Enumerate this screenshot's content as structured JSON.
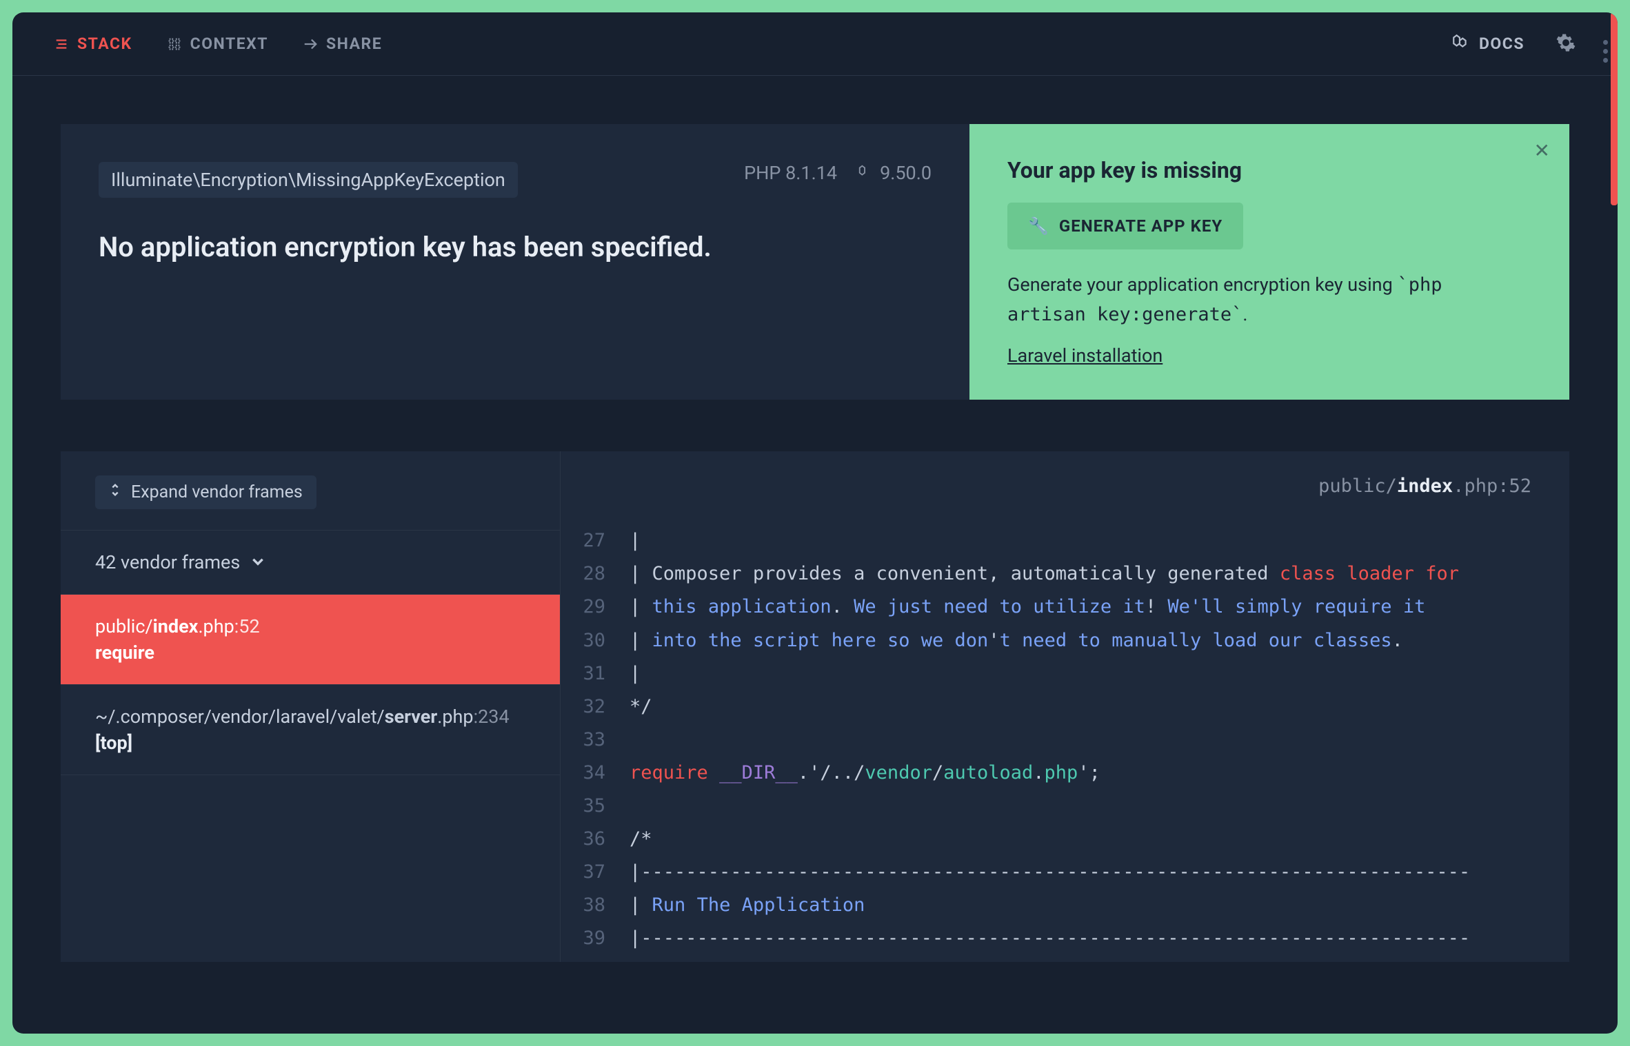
{
  "tabs": {
    "stack": "STACK",
    "context": "CONTEXT",
    "share": "SHARE"
  },
  "docs": "DOCS",
  "exception": "Illuminate\\Encryption\\MissingAppKeyException",
  "php_label": "PHP 8.1.14",
  "laravel_version": "9.50.0",
  "error_message": "No application encryption key has been specified.",
  "solution": {
    "title": "Your app key is missing",
    "button": "GENERATE APP KEY",
    "desc_before": "Generate your application encryption key using ",
    "desc_code": "`php artisan key:generate`",
    "desc_after": ".",
    "link": "Laravel installation"
  },
  "frames": {
    "expand": "Expand vendor frames",
    "vendor_count": "42 vendor frames",
    "f1": {
      "dir": "public/",
      "file": "index",
      "ext": ".php",
      "line": ":52",
      "fn": "require"
    },
    "f2": {
      "dir": "~/.composer/vendor/laravel/valet/",
      "file": "server",
      "ext": ".php",
      "line": ":234",
      "fn": "[top]"
    }
  },
  "code_header": {
    "dir": "public/",
    "file": "index",
    "ext": ".php",
    "line": ":52"
  },
  "code": {
    "l27": {
      "n": "27",
      "pipe": "|"
    },
    "l28": {
      "n": "28",
      "pipe": "| ",
      "t1": "Composer provides a convenient, automatically generated ",
      "kw1": "class",
      "sp1": " ",
      "kw2": "loader",
      "sp2": " ",
      "kw3": "for"
    },
    "l29": {
      "n": "29",
      "pipe": "| ",
      "this": "this",
      "sp1": " ",
      "app": "application",
      "t1": ". ",
      "we": "We",
      "sp2": " ",
      "just": "just",
      "sp3": " ",
      "need": "need",
      "sp4": " ",
      "to": "to",
      "sp5": " ",
      "util": "utilize",
      "sp6": " ",
      "it": "it",
      "bang": "! ",
      "well": "We'll",
      "sp7": " ",
      "simply": "simply",
      "sp8": " ",
      "req": "require",
      "sp9": " ",
      "it2": "it"
    },
    "l30": {
      "n": "30",
      "pipe": "| ",
      "into": "into",
      "sp1": " ",
      "the": "the",
      "sp2": " ",
      "script": "script",
      "sp3": " ",
      "here": "here",
      "sp4": " ",
      "so": "so",
      "sp5": " ",
      "we": "we",
      "sp6": " ",
      "don": "don",
      "apos": "'",
      "t": "t",
      "sp7": " ",
      "need": "need",
      "sp8": " ",
      "to": "to",
      "sp9": " ",
      "man": "manually",
      "sp10": " ",
      "load": "load",
      "sp11": " ",
      "our": "our",
      "sp12": " ",
      "cls": "classes",
      "dot": "."
    },
    "l31": {
      "n": "31",
      "pipe": "|"
    },
    "l32": {
      "n": "32",
      "t": "*/"
    },
    "l33": {
      "n": "33",
      "t": ""
    },
    "l34": {
      "n": "34",
      "req": "require",
      "sp1": " ",
      "dir": "__DIR__",
      "dot1": ".",
      "q1": "'",
      "p1": "/../",
      "vendor": "vendor",
      "sl": "/",
      "auto": "autoload",
      "dot2": ".",
      "php": "php",
      "q2": "'",
      "semi": ";"
    },
    "l35": {
      "n": "35",
      "t": ""
    },
    "l36": {
      "n": "36",
      "t": "/*"
    },
    "l37": {
      "n": "37",
      "pipe": "|",
      "dash": "--------------------------------------------------------------------------"
    },
    "l38": {
      "n": "38",
      "pipe": "| ",
      "run": "Run",
      "sp1": " ",
      "the": "The",
      "sp2": " ",
      "app": "Application"
    },
    "l39": {
      "n": "39",
      "pipe": "|",
      "dash": "--------------------------------------------------------------------------"
    }
  }
}
